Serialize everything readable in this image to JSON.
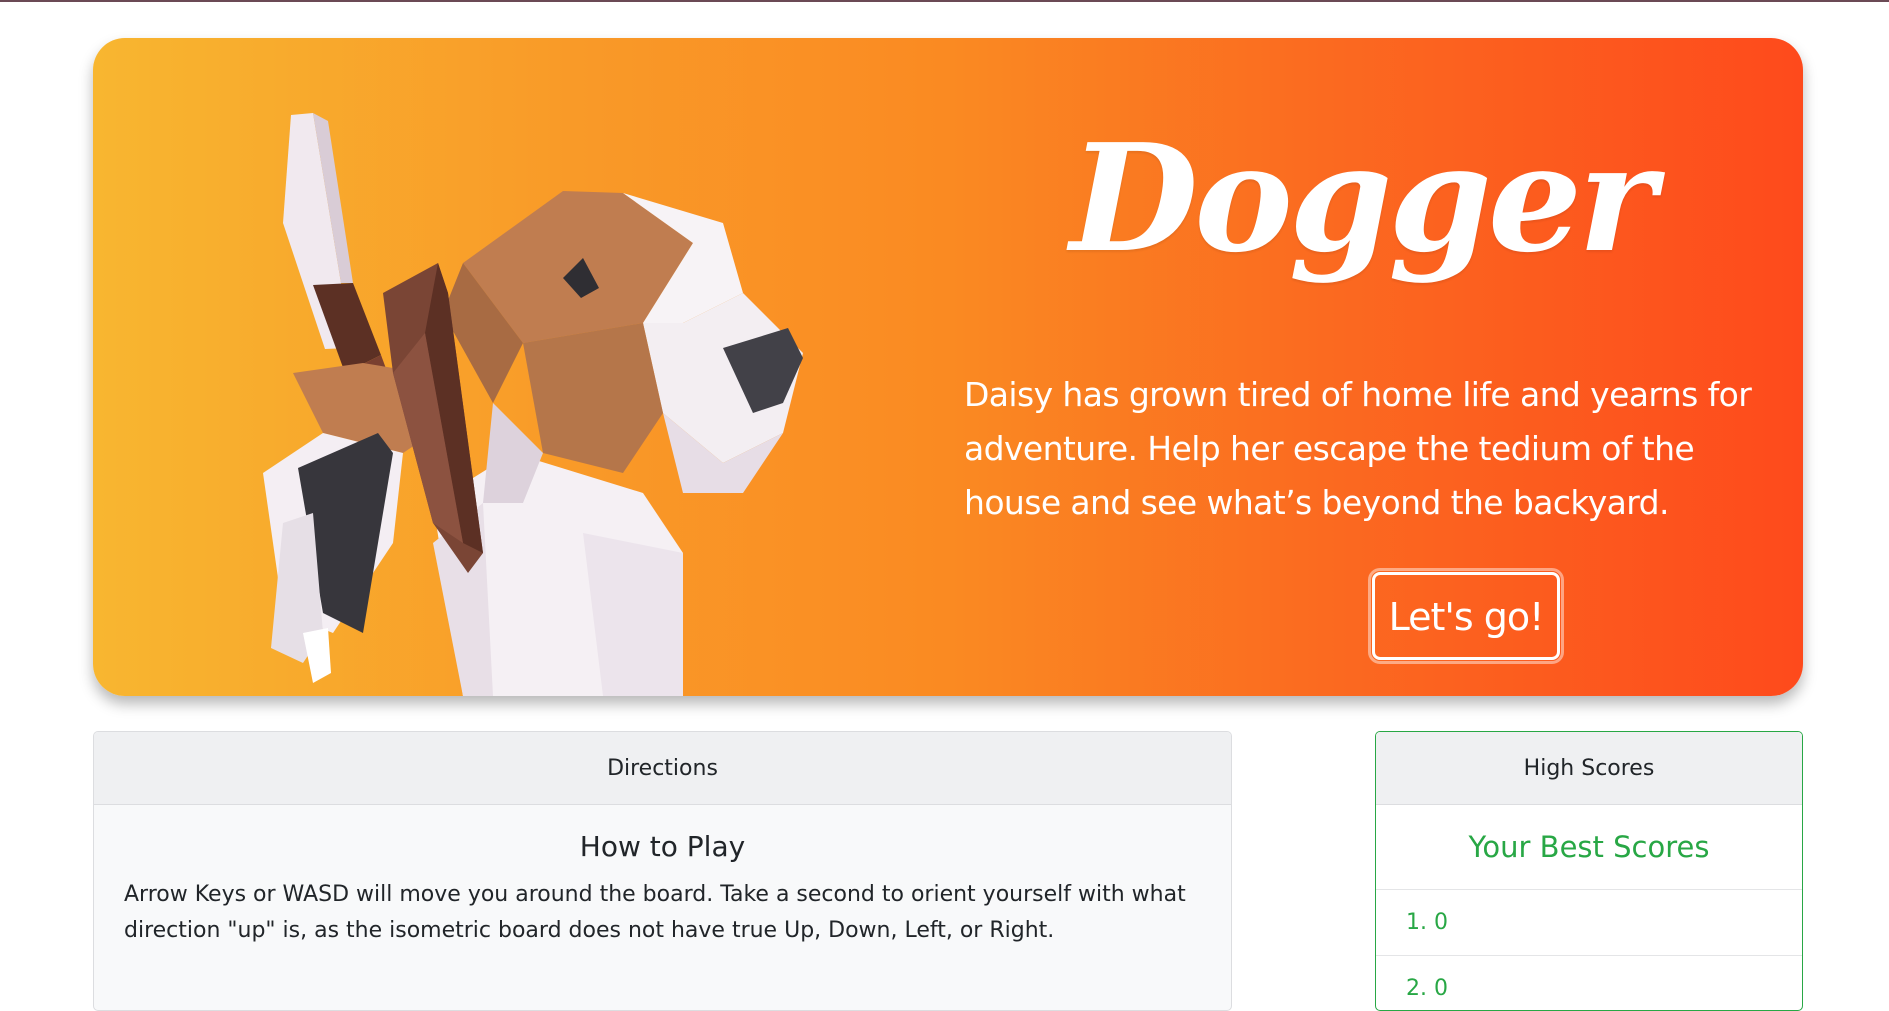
{
  "hero": {
    "title": "Dogger",
    "tagline": "Daisy has grown tired of home life and yearns for adventure. Help her escape the tedium of the house and see what’s beyond the backyard.",
    "button_label": "Let's go!"
  },
  "directions": {
    "header": "Directions",
    "title": "How to Play",
    "text": "Arrow Keys or WASD will move you around the board. Take a second to orient yourself with what direction \"up\" is, as the isometric board does not have true Up, Down, Left, or Right."
  },
  "high_scores": {
    "header": "High Scores",
    "title": "Your Best Scores",
    "items": [
      {
        "label": "1. 0"
      },
      {
        "label": "2. 0"
      }
    ]
  },
  "colors": {
    "gradient_start": "#f8b630",
    "gradient_end": "#fe4a1c",
    "accent_green": "#28a745",
    "text_dark": "#212529"
  },
  "icons": {
    "hero_art": "low-poly-dog-illustration"
  }
}
